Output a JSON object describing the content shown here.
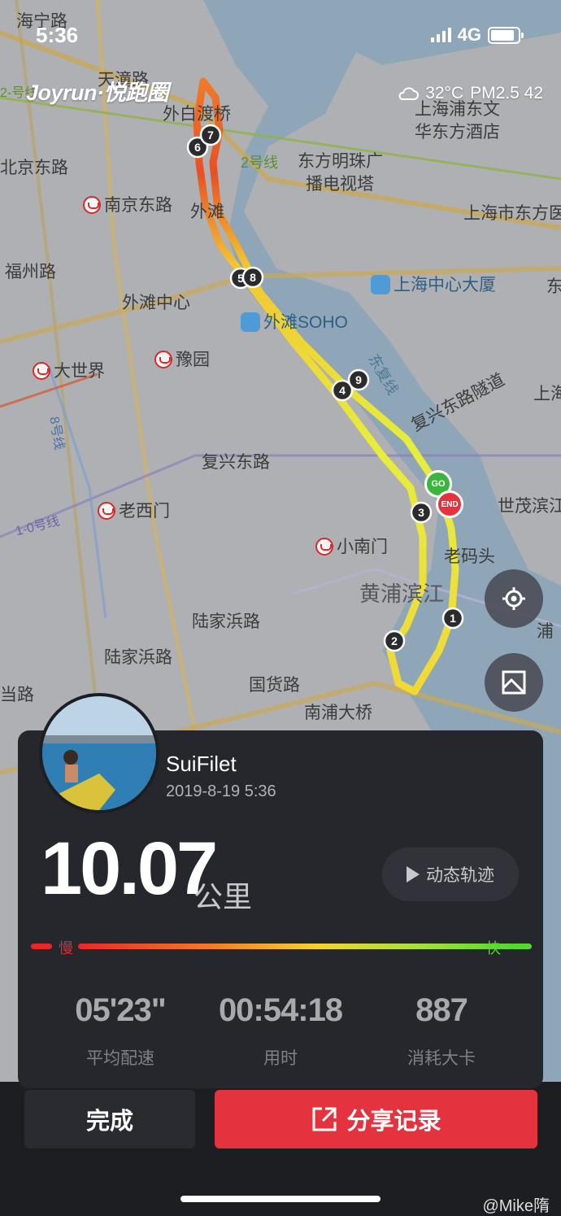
{
  "status_bar": {
    "time": "5:36",
    "network": "4G"
  },
  "brand": {
    "logo_text": "Joyrun·悦跑圈"
  },
  "weather": {
    "temperature": "32°C",
    "pm25": "PM2.5 42"
  },
  "map": {
    "labels": [
      "海宁路",
      "天潼路",
      "外白渡桥",
      "北京东路",
      "南京东路",
      "外滩",
      "福州路",
      "外滩中心",
      "大世界",
      "豫园",
      "复兴东路",
      "老西门",
      "小南门",
      "陆家浜路",
      "陆家浜路",
      "国货路",
      "南浦大桥",
      "当路",
      "黄浦滨江",
      "东方明珠广",
      "播电视塔",
      "上海浦东文",
      "华东方酒店",
      "上海市东方医",
      "上海中心大厦",
      "世茂滨江",
      "复兴东路隧道",
      "东复线",
      "外滩SOHO",
      "老码头",
      "2-号线",
      "2号线",
      "8号线",
      "1-0号线",
      "浦",
      "上海",
      "东"
    ],
    "km_markers": [
      "1",
      "2",
      "3",
      "4",
      "5",
      "6",
      "7",
      "8",
      "9"
    ],
    "start_label": "GO",
    "end_label": "END"
  },
  "summary": {
    "username": "SuiFilet",
    "datetime": "2019-8-19 5:36",
    "distance": "10.07",
    "distance_unit": "公里",
    "replay_label": "动态轨迹",
    "speed_slow_label": "慢",
    "speed_fast_label": "快",
    "stats": [
      {
        "value": "05'23\"",
        "label": "平均配速"
      },
      {
        "value": "00:54:18",
        "label": "用时"
      },
      {
        "value": "887",
        "label": "消耗大卡"
      }
    ]
  },
  "actions": {
    "done_label": "完成",
    "share_label": "分享记录"
  },
  "watermark": "@Mike隋",
  "colors": {
    "accent": "#e5323f",
    "slow": "#e7282b",
    "fast": "#56d62f",
    "card_bg": "#26272c"
  }
}
